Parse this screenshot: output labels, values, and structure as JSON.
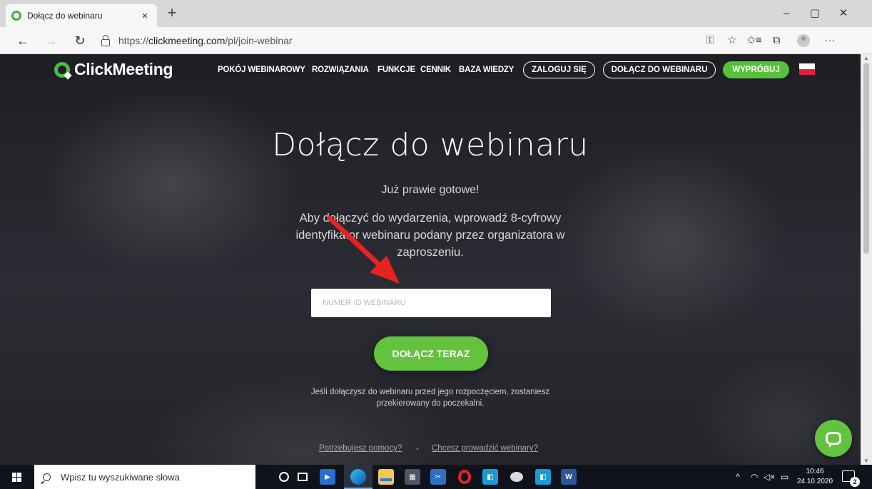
{
  "browser": {
    "tab_title": "Dołącz do webinaru",
    "tab_close": "×",
    "new_tab": "+",
    "url_prefix": "https://",
    "url_host": "clickmeeting.com",
    "url_path": "/pl/join-webinar",
    "window_controls": {
      "minimize": "–",
      "restore": "▢",
      "close": "✕"
    },
    "nav": {
      "back": "←",
      "forward": "→",
      "refresh": "↻"
    },
    "toolbar": {
      "key": "⚿",
      "favorite": "☆",
      "favorites": "✩≡",
      "collections": "⧉",
      "more": "···"
    }
  },
  "site": {
    "logo_text": "ClickMeeting",
    "nav_items": [
      "POKÓJ WEBINAROWY",
      "ROZWIĄZANIA",
      "FUNKCJE",
      "CENNIK",
      "BAZA WIEDZY"
    ],
    "login_label": "ZALOGUJ SIĘ",
    "join_nav_label": "DOŁĄCZ DO WEBINARU",
    "try_label": "WYPRÓBUJ",
    "language_flag": "pl-flag-icon",
    "accent_color": "#63c23e"
  },
  "main": {
    "title": "Dołącz do webinaru",
    "subtitle": "Już prawie gotowe!",
    "description": "Aby dołączyć do wydarzenia, wprowadź 8-cyfrowy identyfikator webinaru podany przez organizatora w zaproszeniu.",
    "id_input": {
      "placeholder": "NUMER ID WEBINARU",
      "value": ""
    },
    "join_button": "DOŁĄCZ TERAZ",
    "note": "Jeśli dołączysz do webinaru przed jego rozpoczęciem, zostaniesz przekierowany do poczekalni.",
    "help_link": "Potrzebujesz pomocy?",
    "host_link": "Chcesz prowadzić webinary?",
    "annotation": "red-arrow pointing to input"
  },
  "taskbar": {
    "search_placeholder": "Wpisz tu wyszukiwane słowa",
    "apps": [
      "cortana",
      "task-view",
      "media-player",
      "edge",
      "file-explorer",
      "calculator",
      "snipping",
      "opera",
      "store-app",
      "paint",
      "store-app-2",
      "word"
    ],
    "tray": {
      "chevron": "^",
      "wifi": "◠",
      "volume": "◁×",
      "battery": "▭"
    },
    "time": "10:46",
    "date": "24.10.2020",
    "notification_count": "2"
  }
}
